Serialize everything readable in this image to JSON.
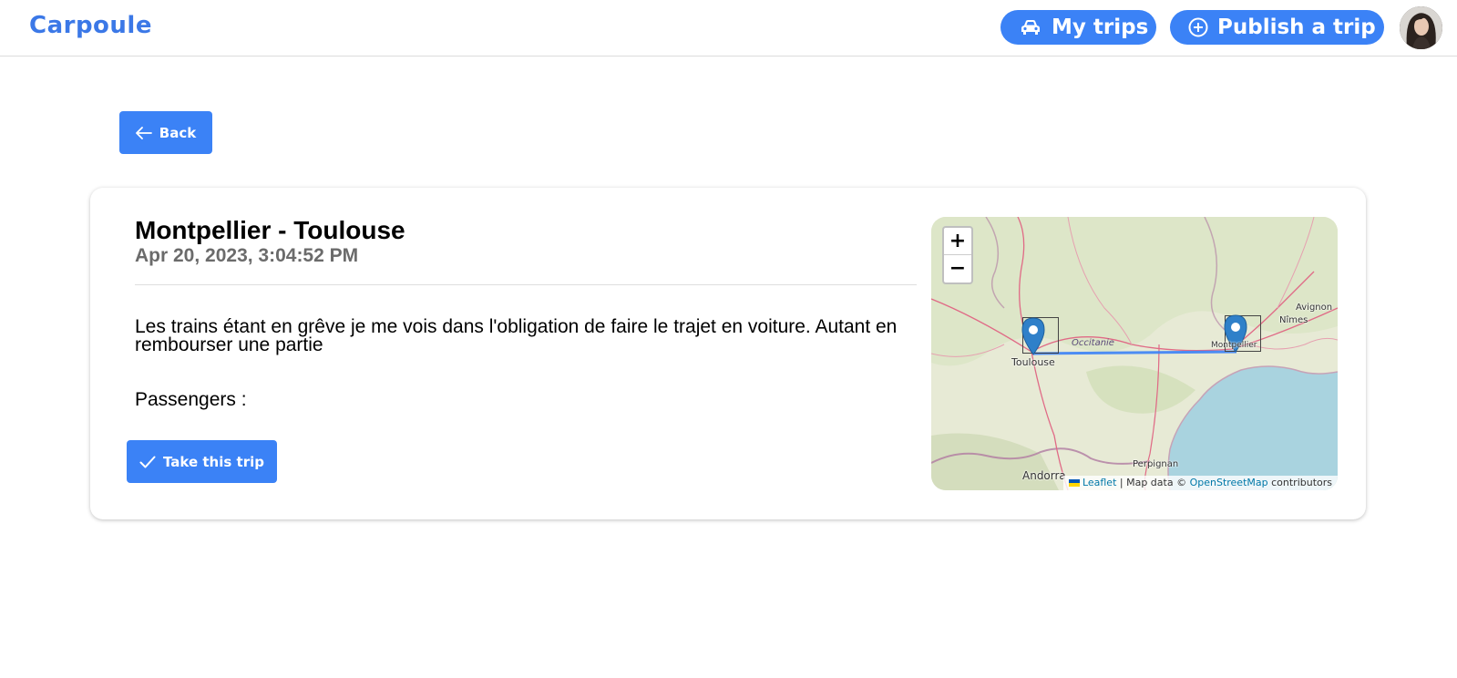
{
  "header": {
    "logo": "Carpoule",
    "my_trips_label": "My trips",
    "publish_label": "Publish a trip",
    "accent_color": "#3b82f6"
  },
  "back_label": "Back",
  "trip": {
    "title": "Montpellier - Toulouse",
    "date": "Apr 20, 2023, 3:04:52 PM",
    "description": "Les trains étant en grêve je me vois dans l'obligation de faire le trajet en voiture. Autant en rembourser une partie",
    "passengers_label": "Passengers :",
    "take_label": "Take this trip"
  },
  "map": {
    "zoom_in": "+",
    "zoom_out": "−",
    "labels": {
      "toulouse": "Toulouse",
      "montpellier": "Montpellier",
      "nimes": "Nîmes",
      "avignon": "Avignon",
      "perpignan": "Perpignan",
      "andorra": "Andorra",
      "region": "Occitanie"
    },
    "attribution": {
      "leaflet": "Leaflet",
      "middle": " | Map data © ",
      "osm": "OpenStreetMap",
      "suffix": " contributors"
    }
  }
}
